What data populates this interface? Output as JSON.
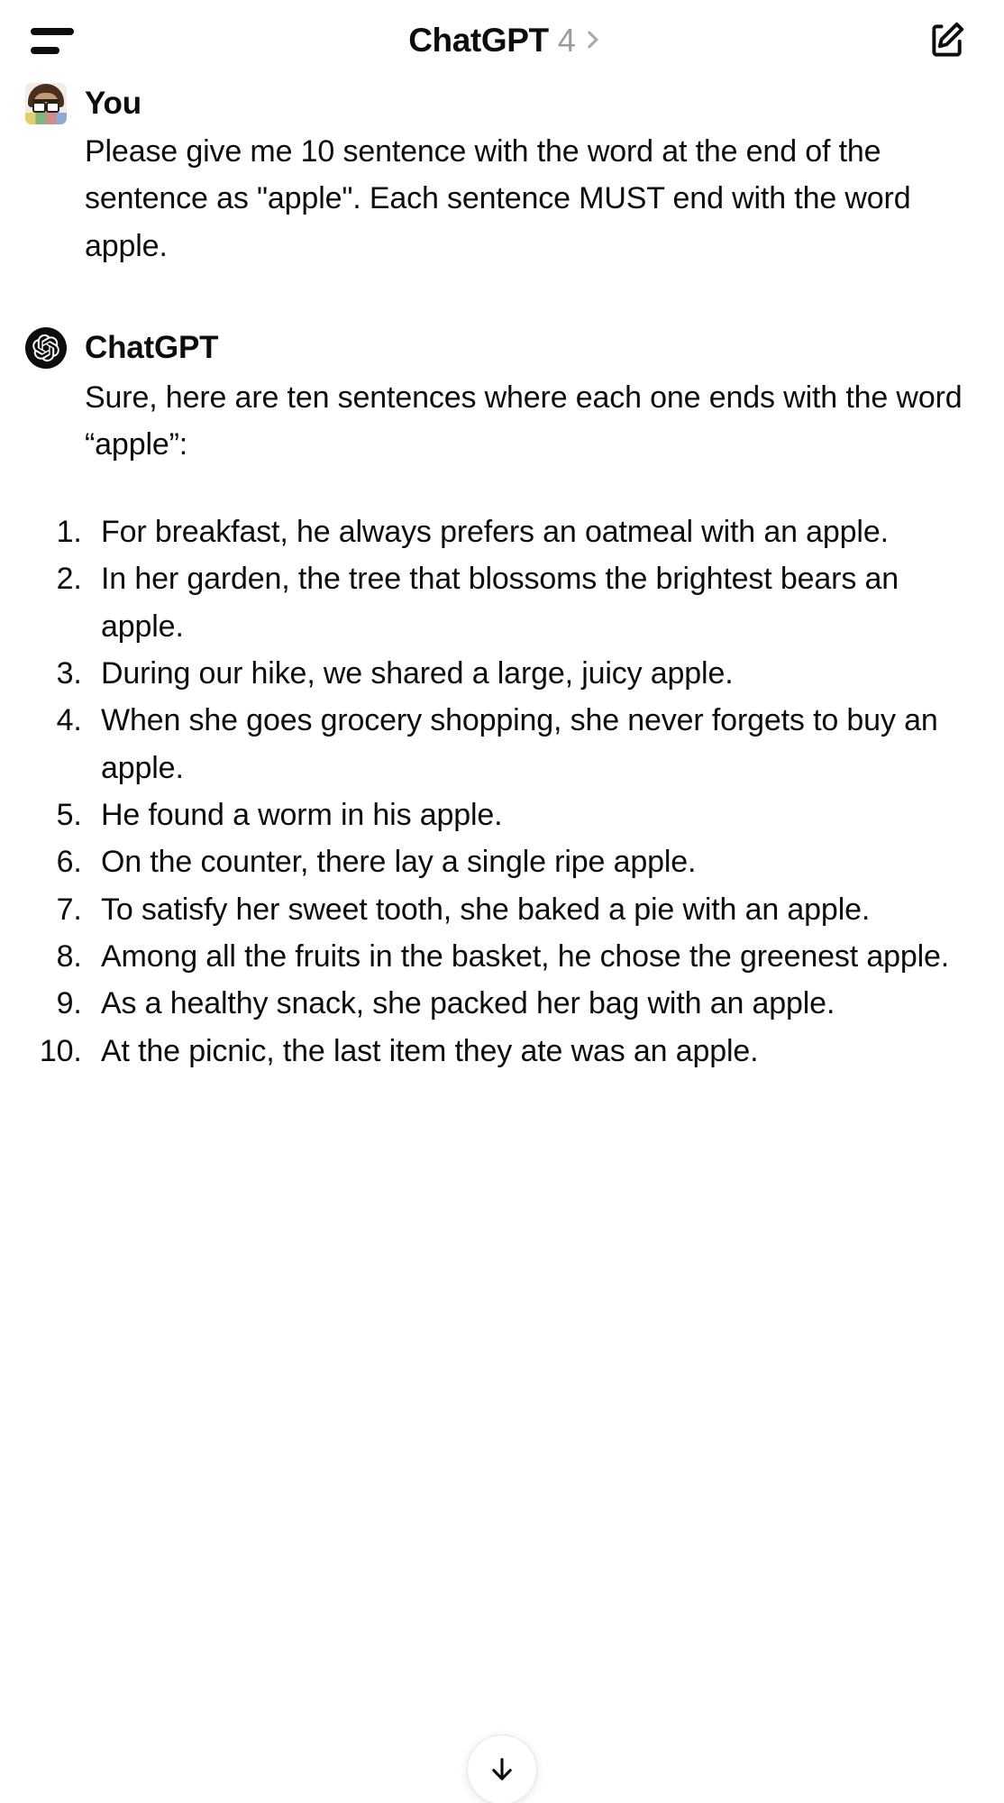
{
  "header": {
    "menu_icon": "hamburger-icon",
    "title_main": "ChatGPT",
    "title_version": "4",
    "chevron_icon": "chevron-right-icon",
    "compose_icon": "compose-icon"
  },
  "conversation": {
    "user_message": {
      "author": "You",
      "avatar_icon": "user-avatar",
      "text": "Please give me 10 sentence with the word at the end of the sentence as \"apple\". Each sentence MUST end with the word apple."
    },
    "assistant_message": {
      "author": "ChatGPT",
      "avatar_icon": "openai-logo-icon",
      "intro": "Sure, here are ten sentences where each one ends with the word “apple”:",
      "list_items": [
        "For breakfast, he always prefers an oatmeal with an apple.",
        "In her garden, the tree that blossoms the brightest bears an apple.",
        "During our hike, we shared a large, juicy apple.",
        "When she goes grocery shopping, she never forgets to buy an apple.",
        "He found a worm in his apple.",
        "On the counter, there lay a single ripe apple.",
        "To satisfy her sweet tooth, she baked a pie with an apple.",
        "Among all the fruits in the basket, he chose the greenest apple.",
        "As a healthy snack, she packed her bag with an apple.",
        "At the picnic, the last item they ate was an apple."
      ]
    }
  },
  "scroll_to_bottom": {
    "icon": "arrow-down-icon"
  },
  "colors": {
    "background": "#ffffff",
    "text": "#0d0d0d",
    "muted": "#9b9b9b",
    "avatar_bg": "#0d0d0d"
  }
}
